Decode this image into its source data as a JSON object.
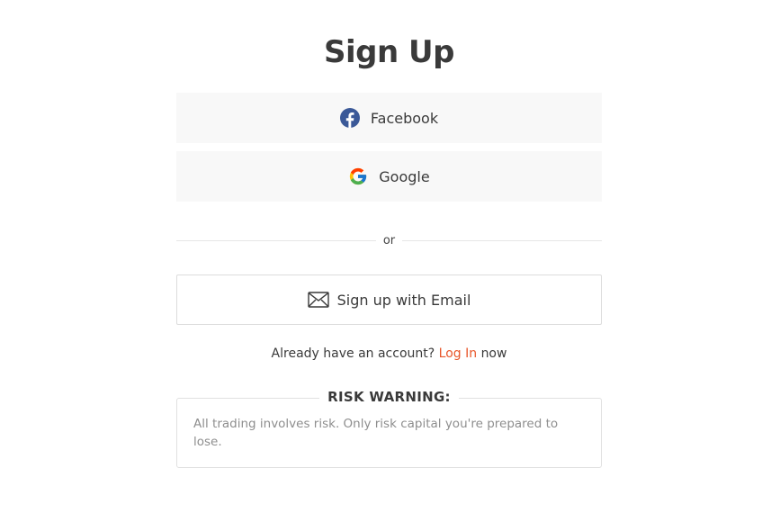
{
  "title": "Sign Up",
  "social": {
    "facebook_label": "Facebook",
    "google_label": "Google"
  },
  "divider_text": "or",
  "email_button_label": "Sign up with Email",
  "login": {
    "prefix": "Already have an account?",
    "link_label": "Log In",
    "suffix": "now"
  },
  "risk": {
    "title": "RISK WARNING:",
    "text": "All trading involves risk. Only risk capital you're prepared to lose."
  },
  "icons": {
    "facebook": "facebook-icon",
    "google": "google-icon",
    "email": "envelope-icon"
  },
  "colors": {
    "accent": "#e8562a",
    "facebook_blue": "#3b5998",
    "button_bg": "#f8f8f8"
  }
}
